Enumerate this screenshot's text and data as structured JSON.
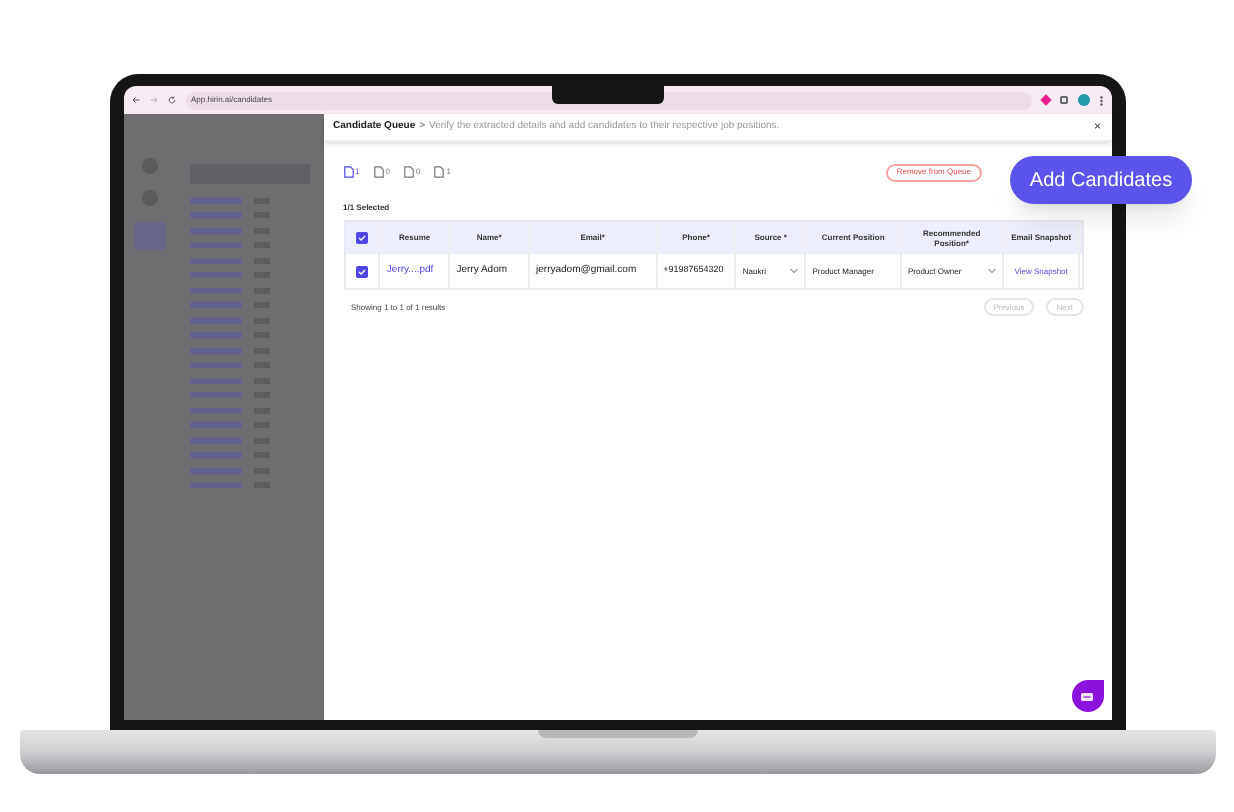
{
  "browser": {
    "url": "App.hirin.ai/candidates"
  },
  "panel": {
    "title": "Candidate Queue",
    "separator": ">",
    "description": "Verify the extracted details and add candidates to their respective job positions.",
    "close": "×"
  },
  "file_tabs": [
    {
      "count": "1",
      "selected": true
    },
    {
      "count": "0",
      "selected": false
    },
    {
      "count": "0",
      "selected": false
    },
    {
      "count": "1",
      "selected": false
    }
  ],
  "remove_button": "Remove from Queue",
  "add_button": "Add Candidates",
  "selection_summary": "1/1 Selected",
  "table": {
    "all_checked": true,
    "columns": [
      "Resume",
      "Name*",
      "Email*",
      "Phone*",
      "Source *",
      "Current Position",
      "Recommended Position*",
      "Email Snapshot"
    ],
    "rows": [
      {
        "checked": true,
        "resume": "Jerry....pdf",
        "name": "Jerry Adom",
        "email": "jerryadom@gmail.com",
        "phone": "+91987654320",
        "source": "Naukri",
        "current_position": "Product Manager",
        "recommended_position": "Product Owner",
        "snapshot": "View Snapshot"
      }
    ]
  },
  "footer": {
    "summary": "Showing 1 to 1 of 1 results",
    "buttons": [
      {
        "label": "Previous",
        "disabled": true
      },
      {
        "label": "Next",
        "disabled": true
      }
    ]
  }
}
